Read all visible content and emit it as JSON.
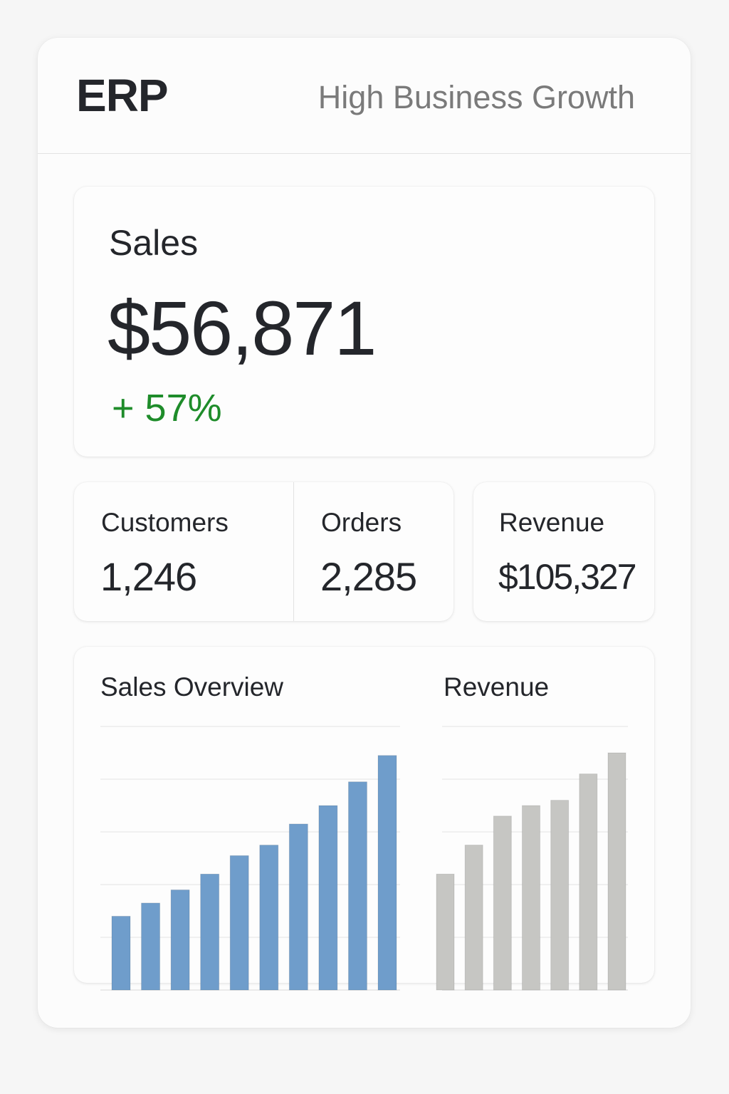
{
  "header": {
    "brand": "ERP",
    "tagline": "High Business Growth"
  },
  "sales": {
    "title": "Sales",
    "value": "$56,871",
    "change": "+ 57%"
  },
  "stats": [
    {
      "label": "Customers",
      "value": "1,246"
    },
    {
      "label": "Orders",
      "value": "2,285"
    },
    {
      "label": "Revenue",
      "value": "$105,327"
    }
  ],
  "colors": {
    "positive": "#1e8c2a",
    "sales_bars": "#6f9dcb",
    "revenue_bars": "#c6c6c3",
    "gridline": "#e4e4e4"
  },
  "chart_data": [
    {
      "type": "bar",
      "title": "Sales Overview",
      "xlabel": "",
      "ylabel": "",
      "ylim": [
        0,
        5
      ],
      "grid": true,
      "values": [
        1.4,
        1.65,
        1.9,
        2.2,
        2.55,
        2.75,
        3.15,
        3.5,
        3.95,
        4.45
      ]
    },
    {
      "type": "bar",
      "title": "Revenue",
      "xlabel": "",
      "ylabel": "",
      "ylim": [
        0,
        5
      ],
      "grid": true,
      "values": [
        2.2,
        2.75,
        3.3,
        3.5,
        3.6,
        4.1,
        4.5
      ]
    }
  ]
}
